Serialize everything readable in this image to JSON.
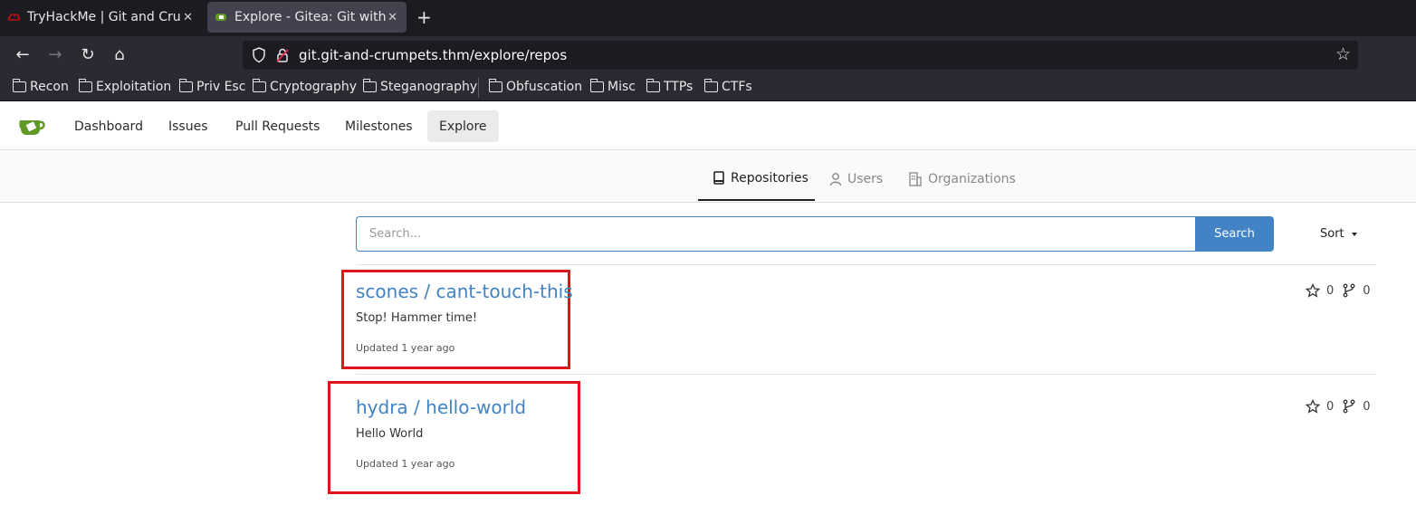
{
  "browser": {
    "tabs": [
      {
        "title": "TryHackMe | Git and Crumpets",
        "active": false
      },
      {
        "title": "Explore - Gitea: Git with a cup of tea",
        "active": true
      }
    ],
    "url": "git.git-and-crumpets.thm/explore/repos",
    "bookmarks": [
      "Recon",
      "Exploitation",
      "Priv Esc",
      "Cryptography",
      "Steganography",
      "Obfuscation",
      "Misc",
      "TTPs",
      "CTFs"
    ]
  },
  "gitea": {
    "nav": [
      "Dashboard",
      "Issues",
      "Pull Requests",
      "Milestones",
      "Explore"
    ],
    "active_nav": "Explore",
    "tabs": [
      "Repositories",
      "Users",
      "Organizations"
    ],
    "active_tab": "Repositories",
    "search": {
      "placeholder": "Search...",
      "button": "Search"
    },
    "sort_label": "Sort"
  },
  "repos": [
    {
      "name": "scones / cant-touch-this",
      "description": "Stop! Hammer time!",
      "updated": "Updated 1 year ago",
      "stars": "0",
      "forks": "0"
    },
    {
      "name": "hydra / hello-world",
      "description": "Hello World",
      "updated": "Updated 1 year ago",
      "stars": "0",
      "forks": "0"
    }
  ],
  "colors": {
    "link": "#4183c4",
    "highlight": "#e0141b",
    "logo": "#609926"
  }
}
